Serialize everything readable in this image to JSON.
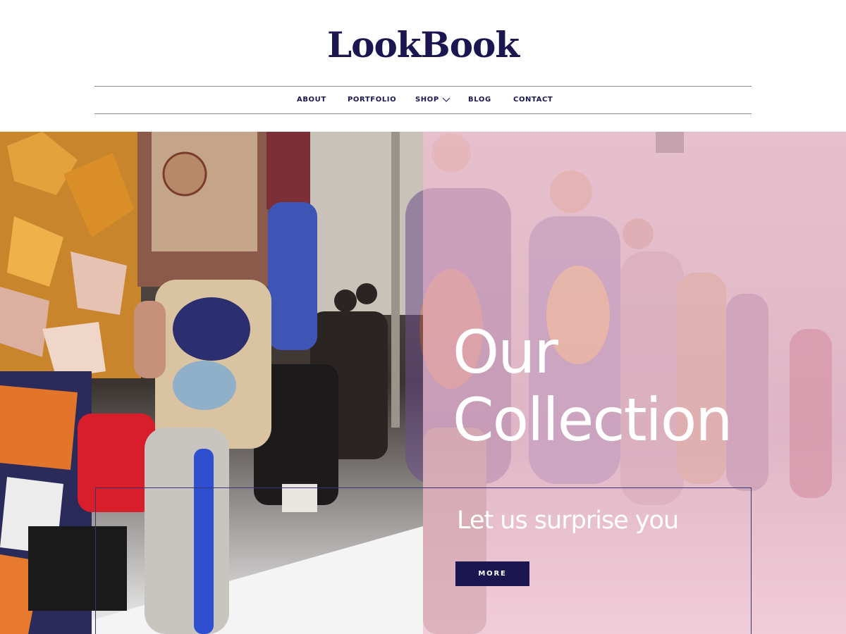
{
  "site": {
    "logo": "LookBook"
  },
  "nav": {
    "items": [
      {
        "label": "ABOUT"
      },
      {
        "label": "PORTFOLIO"
      },
      {
        "label": "SHOP",
        "has_dropdown": true
      },
      {
        "label": "BLOG"
      },
      {
        "label": "CONTACT"
      }
    ]
  },
  "hero": {
    "title_line1": "Our",
    "title_line2": "Collection",
    "subtitle": "Let us surprise you",
    "button_label": "MORE",
    "overlay_color": "#e8b7c9",
    "accent_color": "#1b1650"
  },
  "icons": {
    "dropdown": "chevron-down-icon"
  }
}
